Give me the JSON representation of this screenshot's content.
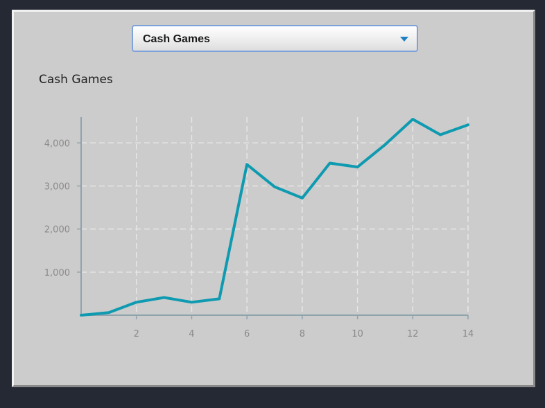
{
  "selector": {
    "value": "Cash Games"
  },
  "colors": {
    "line": "#0e9ab0",
    "grid": "#e6e6e6",
    "axis": "#8fa3ad",
    "panel": "#cccccc"
  },
  "chart_data": {
    "type": "line",
    "title": "Cash Games",
    "xlabel": "",
    "ylabel": "",
    "x": [
      0,
      1,
      2,
      3,
      4,
      5,
      6,
      7,
      8,
      9,
      10,
      11,
      12,
      13,
      14
    ],
    "series": [
      {
        "values": [
          0,
          60,
          300,
          410,
          300,
          380,
          3500,
          2980,
          2720,
          3530,
          3440,
          3960,
          4550,
          4190,
          4420
        ]
      }
    ],
    "xlim": [
      0,
      14
    ],
    "ylim": [
      0,
      4600
    ],
    "xticks": [
      2,
      4,
      6,
      8,
      10,
      12,
      14
    ],
    "xtick_labels": [
      "2",
      "4",
      "6",
      "8",
      "10",
      "12",
      "14"
    ],
    "yticks": [
      1000,
      2000,
      3000,
      4000
    ],
    "ytick_labels": [
      "1,000",
      "2,000",
      "3,000",
      "4,000"
    ],
    "grid": true,
    "legend": "none"
  }
}
